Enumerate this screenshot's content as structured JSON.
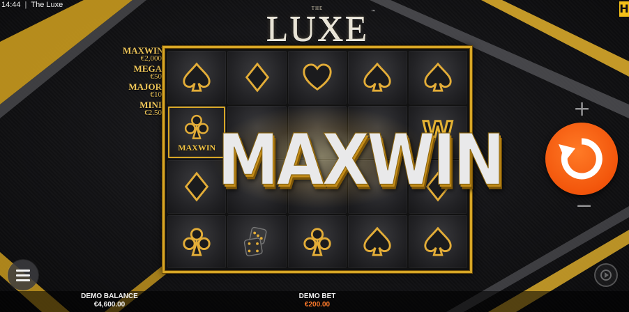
{
  "status_bar": {
    "time": "14:44",
    "separator": "|",
    "app_title": "The Luxe"
  },
  "brand_mark": "H",
  "logo": {
    "small": "THE",
    "main": "LUXE",
    "trademark": "™"
  },
  "jackpots": [
    {
      "name": "MAXWIN",
      "value": "€2,000"
    },
    {
      "name": "MEGA",
      "value": "€50"
    },
    {
      "name": "MAJOR",
      "value": "€10"
    },
    {
      "name": "MINI",
      "value": "€2.50"
    }
  ],
  "reels": {
    "rows": [
      [
        {
          "symbol": "spade"
        },
        {
          "symbol": "diamond"
        },
        {
          "symbol": "heart"
        },
        {
          "symbol": "spade"
        },
        {
          "symbol": "spade"
        }
      ],
      [
        {
          "symbol": "club",
          "label": "MAXWIN",
          "highlight": true
        },
        {
          "symbol": "blank"
        },
        {
          "symbol": "blank"
        },
        {
          "symbol": "blank"
        },
        {
          "symbol": "wild",
          "label": "W"
        }
      ],
      [
        {
          "symbol": "diamond"
        },
        {
          "symbol": "blank"
        },
        {
          "symbol": "blank"
        },
        {
          "symbol": "blank"
        },
        {
          "symbol": "diamond"
        }
      ],
      [
        {
          "symbol": "club"
        },
        {
          "symbol": "dice"
        },
        {
          "symbol": "club"
        },
        {
          "symbol": "spade"
        },
        {
          "symbol": "spade"
        }
      ]
    ]
  },
  "overlay": {
    "text": "MAXWIN"
  },
  "controls": {
    "bet_up": "+",
    "bet_down": "−",
    "spin_icon": "spin-arrow-icon",
    "autoplay_icon": "autoplay-icon",
    "menu_icon": "hamburger-icon"
  },
  "footer": {
    "balance_label": "DEMO BALANCE",
    "balance_value": "€4,600.00",
    "bet_label": "DEMO BET",
    "bet_value": "€200.00"
  },
  "colors": {
    "gold": "#d7a626",
    "spin_orange": "#f2550b",
    "bet_value": "#ff7a2a"
  }
}
